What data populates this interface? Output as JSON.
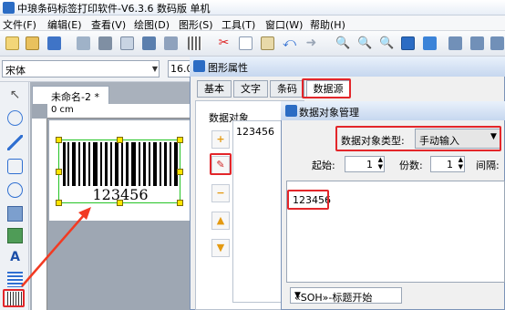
{
  "window": {
    "title": "中琅条码标签打印软件-V6.3.6 数码版 单机"
  },
  "menu": [
    "文件(F)",
    "编辑(E)",
    "查看(V)",
    "绘图(D)",
    "图形(S)",
    "工具(T)",
    "窗口(W)",
    "帮助(H)"
  ],
  "font": {
    "family_value": "宋体",
    "size_value": "16.0"
  },
  "document": {
    "tab_label": "未命名-2 *",
    "ruler_unit": "0 cm",
    "barcode_text": "123456"
  },
  "dialog": {
    "title": "图形属性",
    "tabs": [
      "基本",
      "文字",
      "条码",
      "数据源"
    ],
    "data_objects_label": "数据对象",
    "data_objects": [
      "123456"
    ]
  },
  "manager": {
    "title": "数据对象管理",
    "type_label": "数据对象类型:",
    "type_value": "手动输入",
    "start_label": "起始:",
    "start_value": "1",
    "copies_label": "份数:",
    "copies_value": "1",
    "interval_label": "间隔:",
    "text_value": "123456",
    "bottom_select": "«SOH»-标题开始"
  },
  "colors": {
    "highlight": "#e3262a",
    "arrow": "#f23a22",
    "selection": "#25c425"
  }
}
